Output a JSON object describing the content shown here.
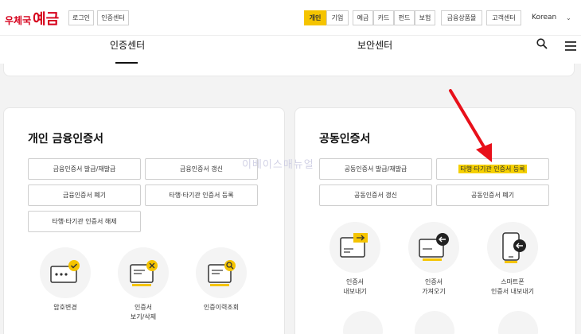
{
  "header": {
    "logo": {
      "part1": "우체국",
      "part2": "예금"
    },
    "auth_buttons": [
      "로그인",
      "인증센터"
    ],
    "segments": [
      "개인",
      "기업"
    ],
    "product_menu": [
      "예금",
      "카드",
      "펀드",
      "보험"
    ],
    "other_menu": [
      "금융상품몰",
      "고객센터"
    ],
    "language": "Korean"
  },
  "subnav": {
    "tabs": [
      "인증센터",
      "보안센터"
    ]
  },
  "left_panel": {
    "title": "개인 금융인증서",
    "buttons": [
      "금융인증서 발급/재발급",
      "금융인증서 갱신",
      "금융인증서 폐기",
      "타행·타기관 인증서 등록",
      "타행·타기관 인증서 해제"
    ],
    "icons": [
      {
        "icon": "password-change-icon",
        "label": "암호변경"
      },
      {
        "icon": "cert-view-delete-icon",
        "label": "인증서\n보기/삭제"
      },
      {
        "icon": "cert-history-icon",
        "label": "인증이력조회"
      }
    ]
  },
  "right_panel": {
    "title": "공동인증서",
    "buttons": [
      "공동인증서 발급/재발급",
      "타행·타기관 인증서 등록",
      "공동인증서 갱신",
      "공동인증서 폐기"
    ],
    "icons": [
      {
        "icon": "cert-export-icon",
        "label": "인증서\n내보내기"
      },
      {
        "icon": "cert-import-icon",
        "label": "인증서\n가져오기"
      },
      {
        "icon": "smartphone-export-icon",
        "label": "스마트폰\n인증서 내보내기"
      }
    ]
  },
  "watermark": "이베이스매뉴얼",
  "colors": {
    "accent": "#f5c400",
    "brand": "#d6001c",
    "arrow": "#e8101a"
  }
}
